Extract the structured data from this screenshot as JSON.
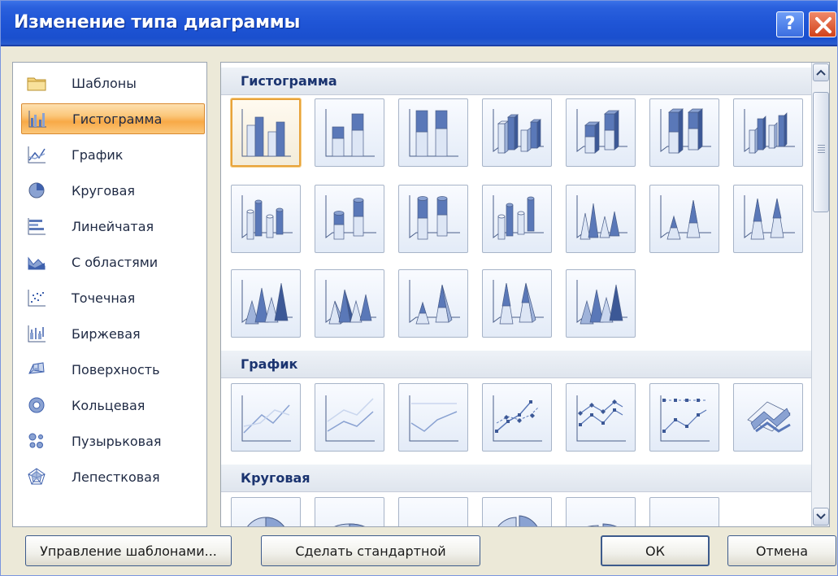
{
  "window": {
    "title": "Изменение типа диаграммы",
    "help_label": "?"
  },
  "left_panel": {
    "items": [
      {
        "label": "Шаблоны",
        "icon": "folder-icon"
      },
      {
        "label": "Гистограмма",
        "icon": "column-chart-icon",
        "selected": true
      },
      {
        "label": "График",
        "icon": "line-chart-icon"
      },
      {
        "label": "Круговая",
        "icon": "pie-chart-icon"
      },
      {
        "label": "Линейчатая",
        "icon": "bar-chart-icon"
      },
      {
        "label": "С областями",
        "icon": "area-chart-icon"
      },
      {
        "label": "Точечная",
        "icon": "scatter-chart-icon"
      },
      {
        "label": "Биржевая",
        "icon": "stock-chart-icon"
      },
      {
        "label": "Поверхность",
        "icon": "surface-chart-icon"
      },
      {
        "label": "Кольцевая",
        "icon": "doughnut-chart-icon"
      },
      {
        "label": "Пузырьковая",
        "icon": "bubble-chart-icon"
      },
      {
        "label": "Лепестковая",
        "icon": "radar-chart-icon"
      }
    ]
  },
  "sections": [
    {
      "title": "Гистограмма",
      "tile_count": 19,
      "selected_index": 0
    },
    {
      "title": "График",
      "tile_count": 7
    },
    {
      "title": "Круговая",
      "tile_count": 6
    }
  ],
  "buttons": {
    "manage_templates": "Управление шаблонами...",
    "set_default": "Сделать стандартной",
    "ok": "ОК",
    "cancel": "Отмена"
  },
  "colors": {
    "title_bar": "#1f55d6",
    "selection": "#f8a947",
    "chart_blue": "#5a78b8",
    "chart_light": "#c9d6ee"
  }
}
